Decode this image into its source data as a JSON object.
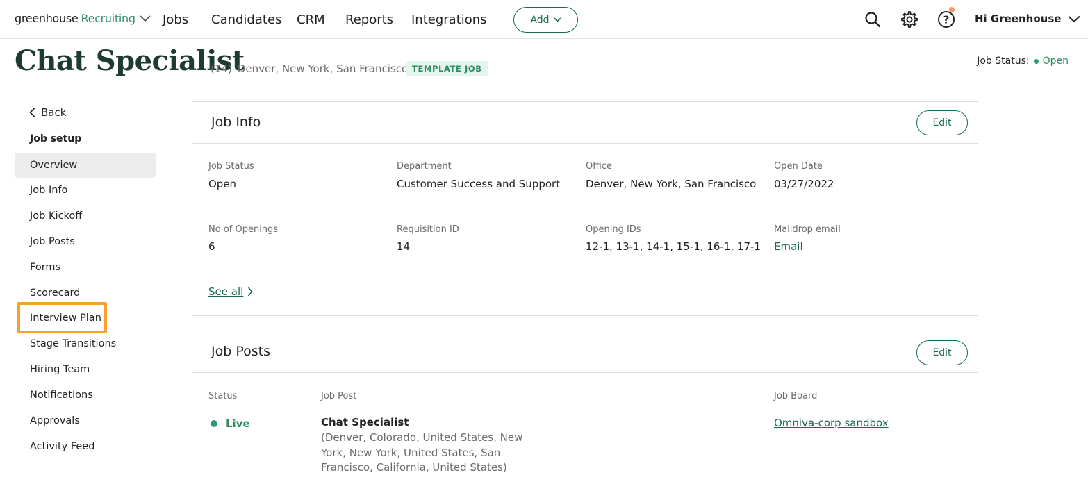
{
  "topnav": {
    "logo_main": "greenhouse",
    "logo_accent": "Recruiting",
    "links": [
      "Jobs",
      "Candidates",
      "CRM",
      "Reports",
      "Integrations"
    ],
    "add_label": "Add",
    "greeting": "Hi Greenhouse",
    "icons": [
      "search-icon",
      "gear-icon",
      "help-icon"
    ],
    "notification_color": "#f39a6b"
  },
  "header": {
    "title": "Chat Specialist",
    "count": "(14)",
    "locations": "Denver, New York, San Francisco",
    "badge": "TEMPLATE JOB",
    "status_label": "Job Status:",
    "status_value": "Open"
  },
  "sidebar": {
    "back_label": "Back",
    "heading": "Job setup",
    "items": [
      {
        "label": "Overview",
        "active": true
      },
      {
        "label": "Job Info"
      },
      {
        "label": "Job Kickoff"
      },
      {
        "label": "Job Posts"
      },
      {
        "label": "Forms"
      },
      {
        "label": "Scorecard"
      },
      {
        "label": "Interview Plan",
        "highlighted": true
      },
      {
        "label": "Stage Transitions"
      },
      {
        "label": "Hiring Team"
      },
      {
        "label": "Notifications"
      },
      {
        "label": "Approvals"
      },
      {
        "label": "Activity Feed"
      }
    ]
  },
  "job_info": {
    "title": "Job Info",
    "edit_label": "Edit",
    "fields": [
      {
        "label": "Job Status",
        "value": "Open"
      },
      {
        "label": "Department",
        "value": "Customer Success and Support"
      },
      {
        "label": "Office",
        "value": "Denver, New York, San Francisco"
      },
      {
        "label": "Open Date",
        "value": "03/27/2022"
      },
      {
        "label": "No of Openings",
        "value": "6"
      },
      {
        "label": "Requisition ID",
        "value": "14"
      },
      {
        "label": "Opening IDs",
        "value": "12-1, 13-1, 14-1, 15-1, 16-1, 17-1"
      },
      {
        "label": "Maildrop email",
        "value": "Email"
      }
    ],
    "see_all": "See all"
  },
  "job_posts": {
    "title": "Job Posts",
    "edit_label": "Edit",
    "headers": [
      "Status",
      "Job Post",
      "Job Board"
    ],
    "row": {
      "status": "Live",
      "post_title": "Chat Specialist",
      "post_location": "(Denver, Colorado, United States, New York, New York, United States, San Francisco, California, United States)",
      "board": "Omniva-corp sandbox"
    }
  },
  "colors": {
    "brand_green": "#186a52",
    "highlight": "#f7a12c",
    "status_green": "#2e9b6c"
  }
}
